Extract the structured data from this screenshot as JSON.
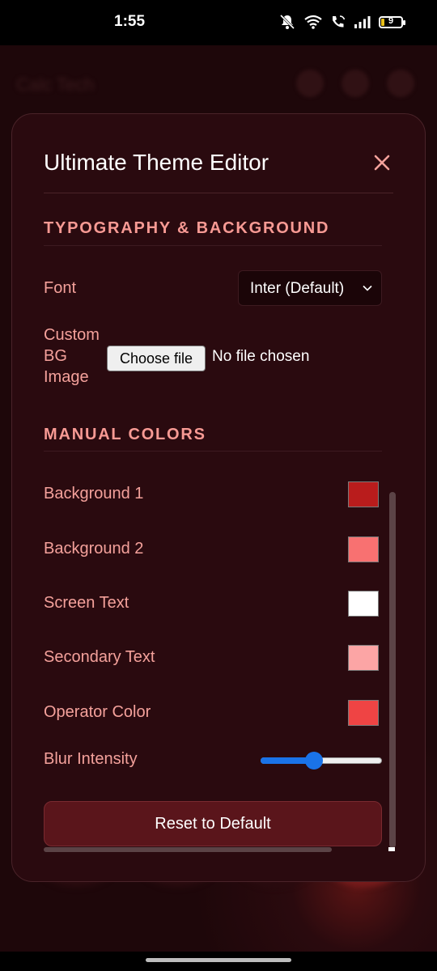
{
  "status_bar": {
    "time": "1:55",
    "battery": "9"
  },
  "background_app": {
    "title": "Calc Tech"
  },
  "modal": {
    "title": "Ultimate Theme Editor",
    "close_icon": "close-icon",
    "sections": {
      "typography": "TYPOGRAPHY & BACKGROUND",
      "manual_colors": "MANUAL COLORS"
    },
    "font": {
      "label": "Font",
      "selected": "Inter (Default)"
    },
    "custom_bg": {
      "label_line1": "Custom",
      "label_line2": "BG",
      "label_line3": "Image",
      "button": "Choose file",
      "status": "No file chosen"
    },
    "colors": [
      {
        "label": "Background 1",
        "value": "#b91c1c"
      },
      {
        "label": "Background 2",
        "value": "#f87171"
      },
      {
        "label": "Screen Text",
        "value": "#ffffff"
      },
      {
        "label": "Secondary Text",
        "value": "#fca5a5"
      },
      {
        "label": "Operator Color",
        "value": "#ef4444"
      }
    ],
    "blur": {
      "label": "Blur Intensity",
      "value_fraction": 0.43
    },
    "reset_label": "Reset to Default"
  }
}
